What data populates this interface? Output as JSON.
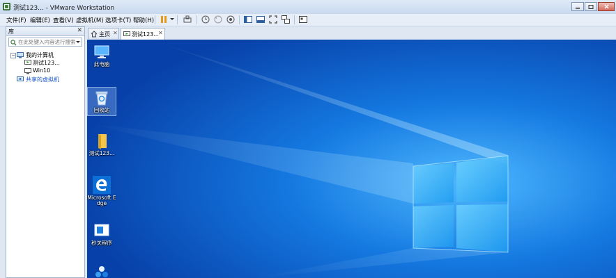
{
  "window": {
    "title": "测试123... - VMware Workstation"
  },
  "menu": {
    "items": [
      {
        "label": "文件(F)"
      },
      {
        "label": "编辑(E)"
      },
      {
        "label": "查看(V)"
      },
      {
        "label": "虚拟机(M)"
      },
      {
        "label": "选项卡(T)"
      },
      {
        "label": "帮助(H)"
      }
    ]
  },
  "toolbar": {
    "icons": [
      "pause-icon",
      "send-ctrl-alt-del-icon",
      "snapshot-icon",
      "revert-snapshot-icon",
      "snapshot-manager-icon",
      "library-view-icon",
      "console-view-icon",
      "fullscreen-icon",
      "unity-icon",
      "thumbnail-icon"
    ]
  },
  "library": {
    "title": "库",
    "close": "✕",
    "search_placeholder": "在此处键入内容进行搜索",
    "tree": {
      "root": {
        "label": "我的计算机",
        "toggle": "−"
      },
      "vms": [
        {
          "label": "测试123..."
        },
        {
          "label": "Win10"
        }
      ],
      "shared": {
        "label": "共享的虚拟机"
      }
    }
  },
  "tabs": [
    {
      "label": "主页",
      "close": "✕"
    },
    {
      "label": "测试123...",
      "close": "✕",
      "active": true
    }
  ],
  "desktop": {
    "icons": [
      {
        "label": "此电脑",
        "icon": "this-pc-icon"
      },
      {
        "label": "回收站",
        "icon": "recycle-bin-icon",
        "selected": true
      },
      {
        "label": "测试123...",
        "icon": "folder-icon"
      },
      {
        "label": "Microsoft Edge",
        "icon": "edge-icon"
      },
      {
        "label": "秒关程序",
        "icon": "app-icon"
      },
      {
        "label": "",
        "icon": "network-icon"
      }
    ]
  },
  "colors": {
    "desktop_blue": "#0a58c8",
    "glow": "#6fd2ff",
    "link": "#1a55c8",
    "close_red": "#d46a5b"
  }
}
